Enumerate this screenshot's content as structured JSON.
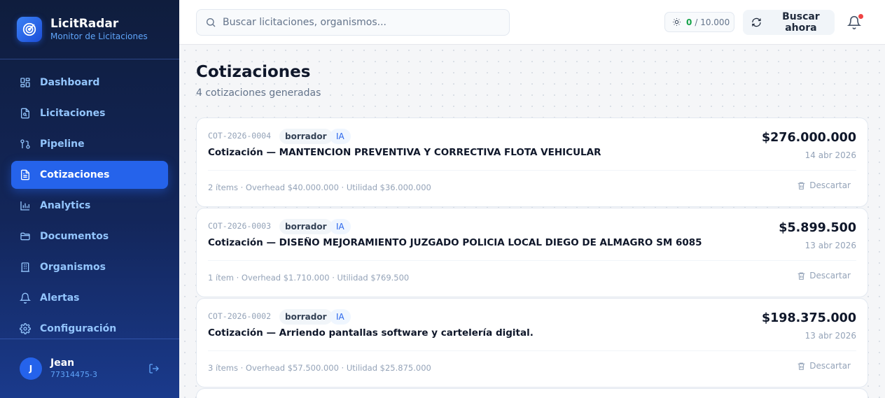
{
  "brand": {
    "name": "LicitRadar",
    "subtitle": "Monitor de Licitaciones"
  },
  "sidebar": {
    "items": [
      {
        "label": "Dashboard",
        "icon": "dashboard-icon",
        "active": false
      },
      {
        "label": "Licitaciones",
        "icon": "file-search-icon",
        "active": false
      },
      {
        "label": "Pipeline",
        "icon": "pipeline-icon",
        "active": false
      },
      {
        "label": "Cotizaciones",
        "icon": "document-icon",
        "active": true
      },
      {
        "label": "Analytics",
        "icon": "bar-chart-icon",
        "active": false
      },
      {
        "label": "Documentos",
        "icon": "folder-icon",
        "active": false
      },
      {
        "label": "Organismos",
        "icon": "building-icon",
        "active": false
      },
      {
        "label": "Alertas",
        "icon": "bell-icon",
        "active": false
      },
      {
        "label": "Configuración",
        "icon": "gear-icon",
        "active": false
      }
    ]
  },
  "user": {
    "initial": "J",
    "name": "Jean",
    "id": "77314475-3"
  },
  "header": {
    "search_placeholder": "Buscar licitaciones, organismos...",
    "quota_used": "0",
    "quota_total": "/ 10.000",
    "search_button": "Buscar ahora",
    "has_notifications": true
  },
  "page": {
    "title": "Cotizaciones",
    "subtitle": "4 cotizaciones generadas"
  },
  "quotes": [
    {
      "code": "COT-2026-0004",
      "status": "borrador",
      "tag": "IA",
      "title": "Cotización — MANTENCION PREVENTIVA Y CORRECTIVA FLOTA VEHICULAR",
      "amount": "$276.000.000",
      "date": "14 abr 2026",
      "meta": "2 ítems · Overhead $40.000.000 · Utilidad $36.000.000",
      "action": "Descartar"
    },
    {
      "code": "COT-2026-0003",
      "status": "borrador",
      "tag": "IA",
      "title": "Cotización — DISEÑO MEJORAMIENTO JUZGADO POLICIA LOCAL DIEGO DE ALMAGRO SM 6085",
      "amount": "$5.899.500",
      "date": "13 abr 2026",
      "meta": "1 ítem · Overhead $1.710.000 · Utilidad $769.500",
      "action": "Descartar"
    },
    {
      "code": "COT-2026-0002",
      "status": "borrador",
      "tag": "IA",
      "title": "Cotización — Arriendo pantallas software y cartelería digital.",
      "amount": "$198.375.000",
      "date": "13 abr 2026",
      "meta": "3 ítems · Overhead $57.500.000 · Utilidad $25.875.000",
      "action": "Descartar"
    }
  ],
  "colors": {
    "accent": "#2563eb",
    "sidebar_bg": "#0f1d3d",
    "success": "#16a34a",
    "alert": "#ef4444"
  }
}
